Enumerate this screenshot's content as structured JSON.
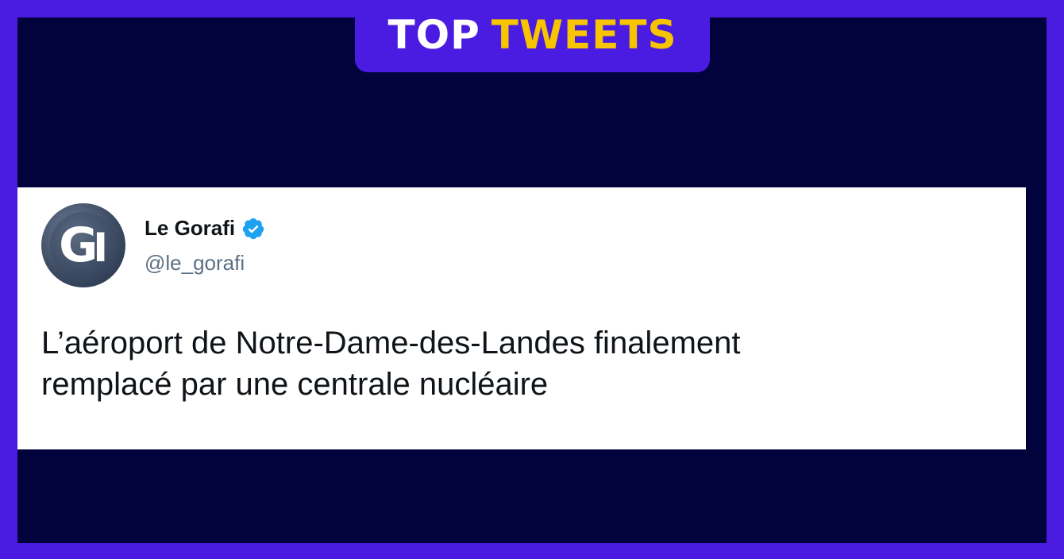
{
  "banner": {
    "word1": "TOP",
    "word2": "TWEETS"
  },
  "colors": {
    "border": "#4a1be0",
    "background": "#02023c",
    "banner_accent": "#f7c500",
    "verified": "#1da1f2"
  },
  "tweet": {
    "avatar_icon": "le-gorafi-logo",
    "name": "Le Gorafi",
    "verified_icon": "verified-badge-icon",
    "handle": "@le_gorafi",
    "text_line1": "L’aéroport de Notre-Dame-des-Landes finalement",
    "text_line2": "remplacé par une centrale nucléaire"
  }
}
